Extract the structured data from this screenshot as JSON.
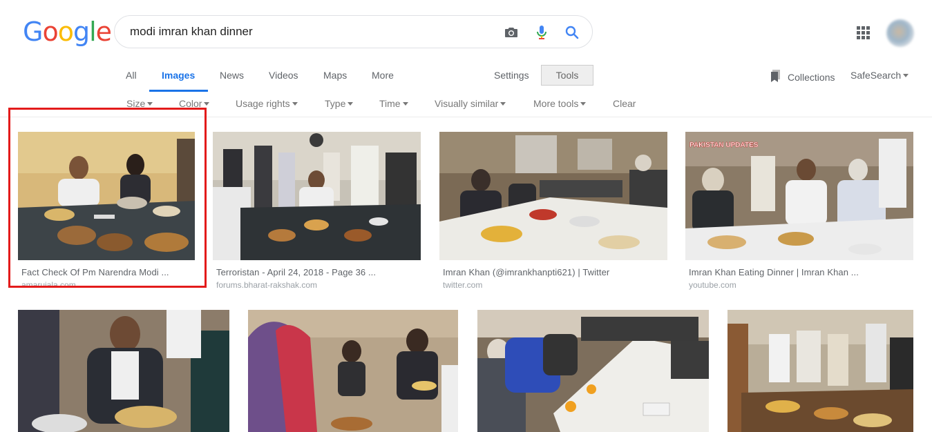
{
  "logo": {
    "letters": [
      "G",
      "o",
      "o",
      "g",
      "l",
      "e"
    ],
    "colors": [
      "#4285f4",
      "#ea4335",
      "#fbbc05",
      "#4285f4",
      "#34a853",
      "#ea4335"
    ]
  },
  "search": {
    "query": "modi imran khan dinner"
  },
  "tabs": [
    {
      "label": "All"
    },
    {
      "label": "Images",
      "active": true
    },
    {
      "label": "News"
    },
    {
      "label": "Videos"
    },
    {
      "label": "Maps"
    },
    {
      "label": "More"
    }
  ],
  "settings_label": "Settings",
  "tools_label": "Tools",
  "collections_label": "Collections",
  "safesearch_label": "SafeSearch",
  "filters": [
    "Size",
    "Color",
    "Usage rights",
    "Type",
    "Time",
    "Visually similar",
    "More tools",
    "Clear"
  ],
  "results": [
    {
      "title": "Fact Check Of Pm Narendra Modi ...",
      "source": "amarujala.com"
    },
    {
      "title": "Terroristan - April 24, 2018 - Page 36 ...",
      "source": "forums.bharat-rakshak.com"
    },
    {
      "title": "Imran Khan (@imrankhanpti621) | Twitter",
      "source": "twitter.com"
    },
    {
      "title": "Imran Khan Eating Dinner | Imran Khan ...",
      "source": "youtube.com"
    }
  ],
  "thumb_overlays": {
    "pakistan_updates": "PAKISTAN UPDATES"
  },
  "colors": {
    "accent": "#1a73e8",
    "highlight": "#e31b1b"
  }
}
